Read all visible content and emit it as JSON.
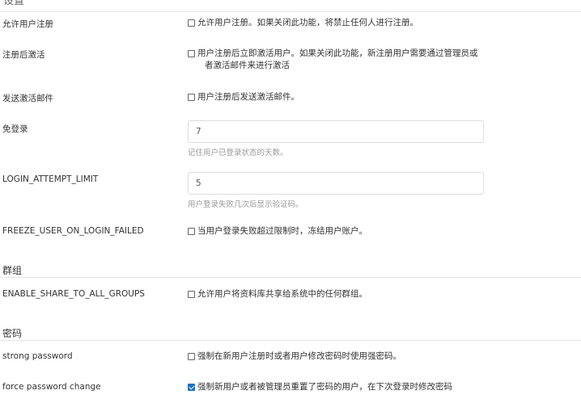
{
  "top_section": {
    "title": "设置"
  },
  "settings": [
    {
      "label": "允许用户注册",
      "checked": false,
      "text": "允许用户注册。如果关闭此功能，将禁止任何人进行注册。"
    },
    {
      "label": "注册后激活",
      "checked": false,
      "text_line1": "用户注册后立即激活用户。如果关闭此功能，新注册用户需要通过管理员或",
      "text_line2": "者激活邮件来进行激活"
    },
    {
      "label": "发送激活邮件",
      "checked": false,
      "text": "用户注册后发送激活邮件。"
    },
    {
      "label": "免登录",
      "value": "7",
      "help": "记住用户已登录状态的天数。"
    },
    {
      "label": "LOGIN_ATTEMPT_LIMIT",
      "value": "5",
      "help": "用户登录失败几次后显示验证码。"
    },
    {
      "label": "FREEZE_USER_ON_LOGIN_FAILED",
      "checked": false,
      "text": "当用户登录失败超过限制时，冻结用户账户。"
    }
  ],
  "group_section": {
    "title": "群组",
    "settings": [
      {
        "label": "ENABLE_SHARE_TO_ALL_GROUPS",
        "checked": false,
        "text": "允许用户将资料库共享给系统中的任何群组。"
      }
    ]
  },
  "password_section": {
    "title": "密码",
    "settings": [
      {
        "label": "strong password",
        "checked": false,
        "text": "强制在新用户注册时或者用户修改密码时使用强密码。"
      },
      {
        "label": "force password change",
        "checked": true,
        "text": "强制新用户或者被管理员重置了密码的用户，在下次登录时修改密码"
      }
    ]
  }
}
